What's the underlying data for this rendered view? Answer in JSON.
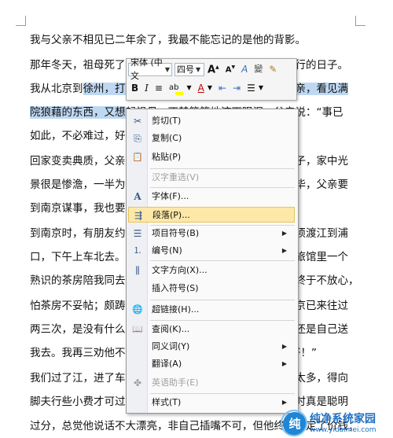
{
  "document": {
    "lines": [
      {
        "text": "我与父亲不相见已二年余了，我最不能忘记的是他的背影。"
      },
      {
        "text": "那年冬天，祖母死了，父亲的差使也交卸了，正是祸不单行的日子。"
      },
      {
        "pre": "我从北京到",
        "hl": "徐州，打算跟着父亲奔丧回家。到徐州见着父亲，看见满",
        "post": ""
      },
      {
        "pre": "",
        "hl": "院狼藉的东西，又想",
        "post": "起祖母，不禁簌簌地流下眼泪。父亲说：“事已"
      },
      {
        "text": "如此，不必难过，好在天无绝人之路！”"
      },
      {
        "text": "回家变卖典质，父亲还了亏空；又借钱办了丧事。这些日子，家中光"
      },
      {
        "text": "景很是惨澹，一半为了丧事，一半为了父亲赋闲。丧事完毕，父亲要"
      },
      {
        "text": "到南京谋事，我也要回北京念书，我们便同行。"
      },
      {
        "text": "到南京时，有朋友约去游逛，勾留了一日；第二日上午便须渡江到浦"
      },
      {
        "text": "口，下午上车北去。父亲因为事忙，本已说定不送我，叫旅馆里一个"
      },
      {
        "text": "熟识的茶房陪我同去。他再三嘱咐茶房，甚是仔细。但他终于不放心，"
      },
      {
        "text": "怕茶房不妥帖；颇踌躇了一会。其实我那年已二十岁，北京已来往过"
      },
      {
        "text": "两三次，是没有什么要紧的了。他踌躇了一会，终于决定还是自己送"
      },
      {
        "text": "我去。我再三劝他不必去；他只说：“不要紧，他们去不好！”"
      },
      {
        "text": "我们过了江，进了车站。我买票，他忙着照看行李。行李太多，得向"
      },
      {
        "text": "脚夫行些小费才可过去。他便又忙着和他们讲价钱。我那时真是聪明"
      },
      {
        "text": "过分，总觉他说话不大漂亮，非自己插嘴不可，但他终于讲定了价钱；"
      }
    ]
  },
  "mini_toolbar": {
    "font_name": "宋体 (中文",
    "font_size": "四号",
    "grow_font": "A",
    "grow_sup": "▲",
    "shrink_font": "A",
    "shrink_sup": "▼",
    "styles": "A",
    "phonetic": "變",
    "format_painter": "✎",
    "bold": "B",
    "italic": "I",
    "center": "≡",
    "highlight": "ab",
    "font_color": "A",
    "decrease_indent": "⇤",
    "increase_indent": "⇥",
    "bullets": "☰"
  },
  "context_menu": {
    "items": [
      {
        "label": "剪切(T)",
        "icon": "scissors-icon",
        "glyph": "✂",
        "enabled": true
      },
      {
        "label": "复制(C)",
        "icon": "copy-icon",
        "glyph": "⎘",
        "enabled": true
      },
      {
        "label": "粘贴(P)",
        "icon": "paste-icon",
        "glyph": "📋",
        "enabled": true
      },
      {
        "label": "汉字重选(V)",
        "icon": "",
        "glyph": "",
        "enabled": false
      },
      {
        "label": "字体(F)...",
        "icon": "font-icon",
        "glyph": "A",
        "enabled": true
      },
      {
        "label": "段落(P)...",
        "icon": "paragraph-icon",
        "glyph": "⇶",
        "enabled": true,
        "active": true
      },
      {
        "label": "项目符号(B)",
        "icon": "bullets-icon",
        "glyph": "☰",
        "enabled": true,
        "submenu": true
      },
      {
        "label": "编号(N)",
        "icon": "numbering-icon",
        "glyph": "⒈",
        "enabled": true,
        "submenu": true
      },
      {
        "label": "文字方向(X)...",
        "icon": "text-direction-icon",
        "glyph": "⫼",
        "enabled": true
      },
      {
        "label": "插入符号(S)",
        "icon": "",
        "glyph": "",
        "enabled": true
      },
      {
        "label": "超链接(H)...",
        "icon": "hyperlink-icon",
        "glyph": "🌐",
        "enabled": true
      },
      {
        "label": "查阅(K)...",
        "icon": "lookup-icon",
        "glyph": "📖",
        "enabled": true
      },
      {
        "label": "同义词(Y)",
        "icon": "",
        "glyph": "",
        "enabled": true,
        "submenu": true
      },
      {
        "label": "翻译(A)",
        "icon": "",
        "glyph": "",
        "enabled": true,
        "submenu": true
      },
      {
        "label": "英语助手(E)",
        "icon": "english-assistant-icon",
        "glyph": "✤",
        "enabled": false
      },
      {
        "label": "样式(T)",
        "icon": "",
        "glyph": "",
        "enabled": true,
        "submenu": true
      }
    ]
  },
  "watermark": {
    "logo_glyph": "纯",
    "title": "纯净系统家园",
    "url": "www.yidaimei.com"
  },
  "colors": {
    "selection": "#bfd8f2",
    "menu_hover": "#fde8a8",
    "brand_blue": "#1f6fc0"
  }
}
